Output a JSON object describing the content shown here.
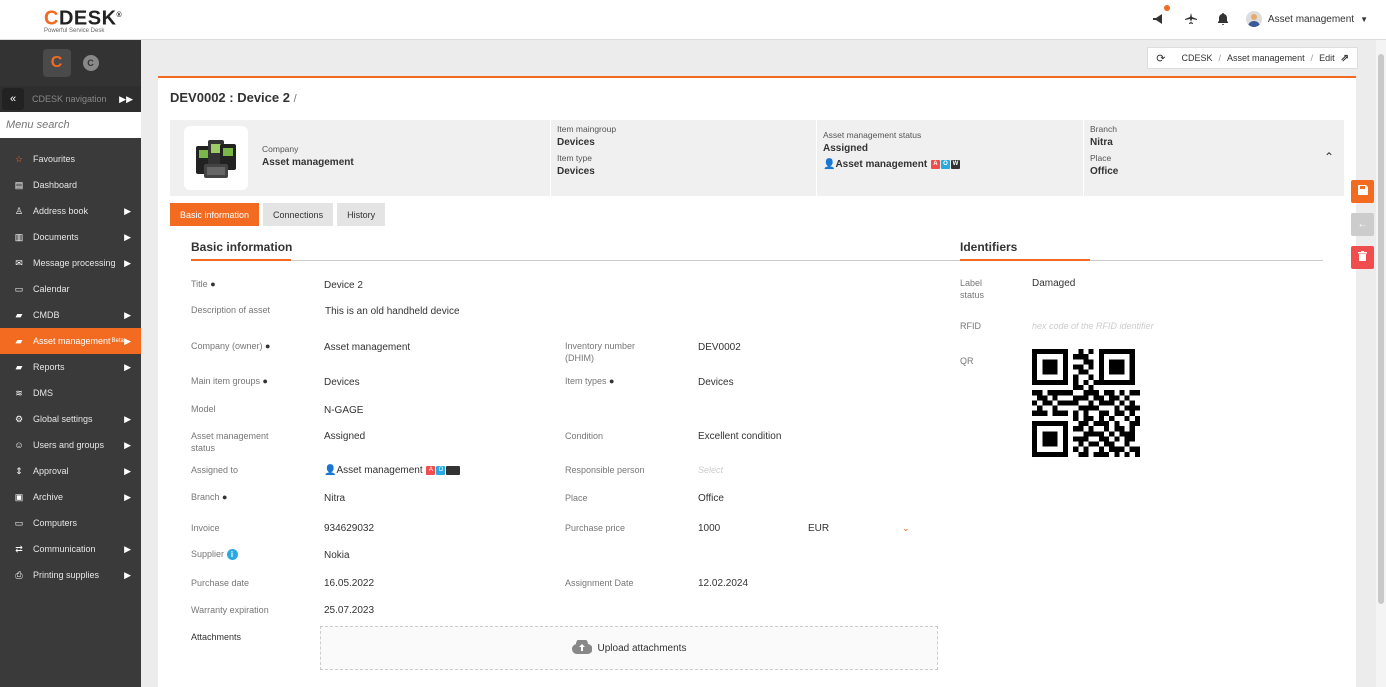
{
  "logo": {
    "brand_prefix": "C",
    "brand_rest": "DESK",
    "reg": "®",
    "tagline": "Powerful Service Desk"
  },
  "header": {
    "user_name": "Asset management"
  },
  "sidebar": {
    "big_logo": "C",
    "small_logo": "C",
    "nav_label": "CDESK navigation",
    "search_placeholder": "Menu search",
    "items": [
      {
        "label": "Favourites",
        "icon": "star-icon",
        "has_arrow": false
      },
      {
        "label": "Dashboard",
        "icon": "dashboard-icon",
        "has_arrow": false
      },
      {
        "label": "Address book",
        "icon": "person-icon",
        "has_arrow": true
      },
      {
        "label": "Documents",
        "icon": "books-icon",
        "has_arrow": true
      },
      {
        "label": "Message processing",
        "icon": "envelope-icon",
        "has_arrow": true
      },
      {
        "label": "Calendar",
        "icon": "calendar-icon",
        "has_arrow": false
      },
      {
        "label": "CMDB",
        "icon": "folder-icon",
        "has_arrow": true
      },
      {
        "label": "Asset management",
        "icon": "folder-icon",
        "has_arrow": true,
        "active": true,
        "badge": "Beta"
      },
      {
        "label": "Reports",
        "icon": "folder-icon",
        "has_arrow": true
      },
      {
        "label": "DMS",
        "icon": "database-icon",
        "has_arrow": false
      },
      {
        "label": "Global settings",
        "icon": "gears-icon",
        "has_arrow": true
      },
      {
        "label": "Users and groups",
        "icon": "users-icon",
        "has_arrow": true
      },
      {
        "label": "Approval",
        "icon": "arrows-icon",
        "has_arrow": true
      },
      {
        "label": "Archive",
        "icon": "archive-icon",
        "has_arrow": true
      },
      {
        "label": "Computers",
        "icon": "laptop-icon",
        "has_arrow": false
      },
      {
        "label": "Communication",
        "icon": "exchange-icon",
        "has_arrow": true
      },
      {
        "label": "Printing supplies",
        "icon": "printer-icon",
        "has_arrow": true
      }
    ]
  },
  "breadcrumb": {
    "root": "CDESK",
    "section": "Asset management",
    "current": "Edit"
  },
  "page": {
    "title": "DEV0002 : Device 2",
    "title_suffix": "/"
  },
  "summary": {
    "company_label": "Company",
    "company_value": "Asset management",
    "maingroup_label": "Item maingroup",
    "maingroup_value": "Devices",
    "itemtype_label": "Item type",
    "itemtype_value": "Devices",
    "status_label": "Asset management status",
    "status_value": "Assigned",
    "assignee_value": "Asset management",
    "branch_label": "Branch",
    "branch_value": "Nitra",
    "place_label": "Place",
    "place_value": "Office"
  },
  "tabs": [
    "Basic information",
    "Connections",
    "History"
  ],
  "basic": {
    "section_title": "Basic information",
    "title_label": "Title",
    "title_value": "Device 2",
    "desc_label": "Description of asset",
    "desc_value": "This is an old handheld device",
    "company_label": "Company (owner)",
    "company_value": "Asset management",
    "inventory_label": "Inventory number (DHIM)",
    "inventory_value": "DEV0002",
    "maingroups_label": "Main item groups",
    "maingroups_value": "Devices",
    "itemtypes_label": "Item types",
    "itemtypes_value": "Devices",
    "model_label": "Model",
    "model_value": "N-GAGE",
    "status_label": "Asset management status",
    "status_value": "Assigned",
    "condition_label": "Condition",
    "condition_value": "Excellent condition",
    "assigned_label": "Assigned to",
    "assigned_value": "Asset management",
    "responsible_label": "Responsible person",
    "responsible_placeholder": "Select",
    "branch_label": "Branch",
    "branch_value": "Nitra",
    "place_label": "Place",
    "place_value": "Office",
    "invoice_label": "Invoice",
    "invoice_value": "934629032",
    "price_label": "Purchase price",
    "price_value": "1000",
    "currency_value": "EUR",
    "supplier_label": "Supplier",
    "supplier_value": "Nokia",
    "purchase_date_label": "Purchase date",
    "purchase_date_value": "16.05.2022",
    "assignment_date_label": "Assignment Date",
    "assignment_date_value": "12.02.2024",
    "warranty_label": "Warranty expiration",
    "warranty_value": "25.07.2023",
    "attachments_label": "Attachments",
    "upload_label": "Upload attachments"
  },
  "identifiers": {
    "section_title": "Identifiers",
    "label_status_label": "Label status",
    "label_status_value": "Damaged",
    "rfid_label": "RFID",
    "rfid_placeholder": "hex code of the RFID identifier",
    "qr_label": "QR"
  },
  "badges": {
    "a": "A",
    "o": "O",
    "w": "W"
  },
  "colors": {
    "accent": "#f26b21",
    "badge_red": "#f04e4e",
    "badge_blue": "#29a9e0",
    "badge_dark": "#333333",
    "delete": "#f04e4e"
  }
}
